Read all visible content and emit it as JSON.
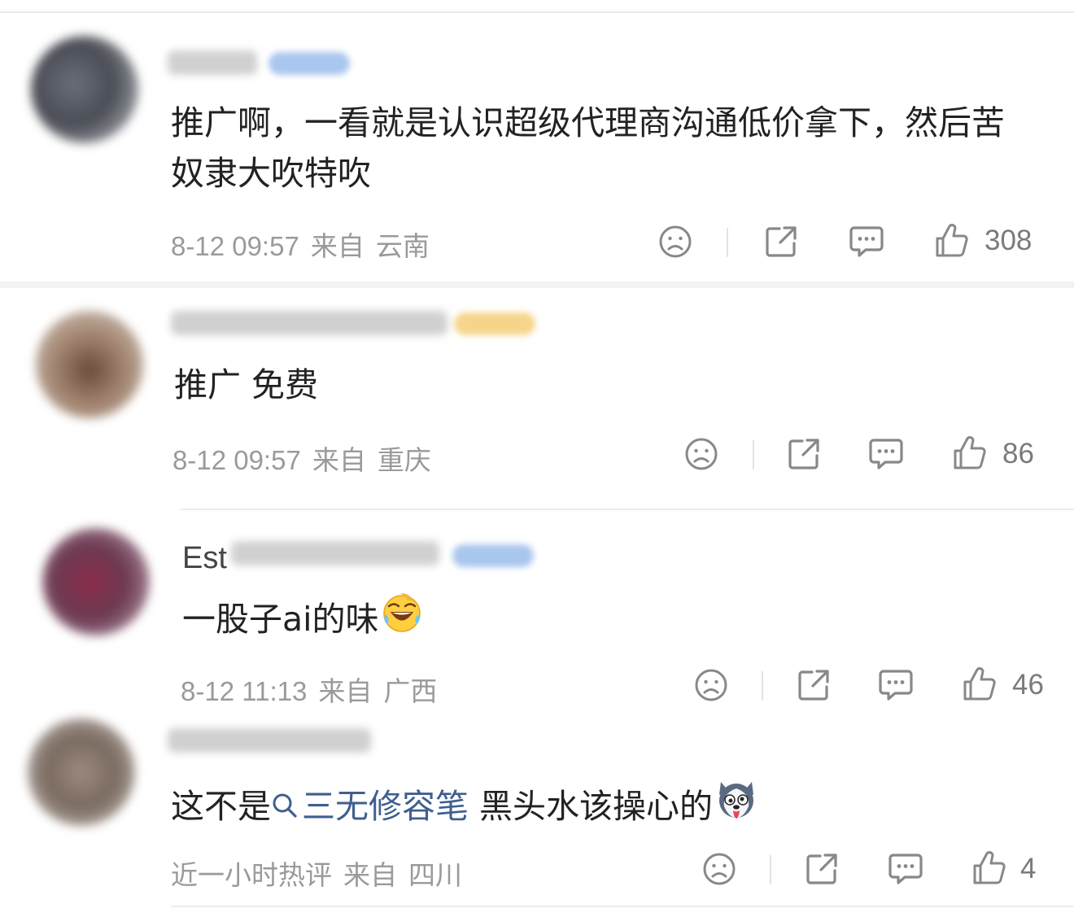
{
  "comments": [
    {
      "content": "推广啊，一看就是认识超级代理商沟通低价拿下，然后苦奴隶大吹特吹",
      "time": "8-12 09:57",
      "from_label": "来自",
      "location": "云南",
      "likes": "308"
    },
    {
      "content": "推广 免费",
      "time": "8-12 09:57",
      "from_label": "来自",
      "location": "重庆",
      "likes": "86"
    },
    {
      "username_visible": "Est",
      "content": "一股子ai的味",
      "time": "8-12 11:13",
      "from_label": "来自",
      "location": "广西",
      "likes": "46"
    },
    {
      "content_before": "这不是",
      "topic_link": "三无修容笔",
      "content_after": " 黑头水该操心的",
      "time": "近一小时热评",
      "from_label": "来自",
      "location": "四川",
      "likes": "4"
    }
  ],
  "icons": {
    "dislike": "frown-face-icon",
    "share": "share-icon",
    "reply": "comment-bubble-icon",
    "like": "thumbs-up-icon",
    "search": "search-icon",
    "emoji_laugh": "laughing-tears-emoji",
    "emoji_husky": "husky-emoji"
  },
  "colors": {
    "link": "#3f5f8f",
    "meta": "#9a9a9a",
    "text": "#222222"
  }
}
